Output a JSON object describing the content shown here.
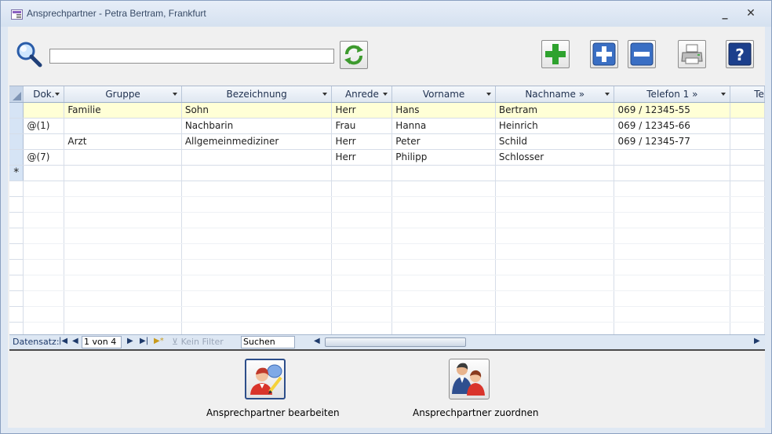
{
  "window": {
    "title": "Ansprechpartner - Petra Bertram, Frankfurt",
    "minimize_glyph": "_",
    "close_glyph": "✕"
  },
  "toolbar": {
    "search_value": "",
    "icons": [
      "search-icon",
      "refresh-icon",
      "add-icon",
      "plus-icon",
      "minus-icon",
      "print-icon",
      "help-icon"
    ]
  },
  "grid": {
    "columns": [
      {
        "label": "Dok.",
        "dropdown": true
      },
      {
        "label": "Gruppe",
        "dropdown": true
      },
      {
        "label": "Bezeichnung",
        "dropdown": true
      },
      {
        "label": "Anrede",
        "dropdown": true
      },
      {
        "label": "Vorname",
        "dropdown": true
      },
      {
        "label": "Nachname »",
        "dropdown": true
      },
      {
        "label": "Telefon 1 »",
        "dropdown": true
      },
      {
        "label": "Te",
        "dropdown": false
      }
    ],
    "rows": [
      [
        "",
        "Familie",
        "Sohn",
        "Herr",
        "Hans",
        "Bertram",
        "069 / 12345-55",
        ""
      ],
      [
        "@(1)",
        "",
        "Nachbarin",
        "Frau",
        "Hanna",
        "Heinrich",
        "069 / 12345-66",
        ""
      ],
      [
        "",
        "Arzt",
        "Allgemeinmediziner",
        "Herr",
        "Peter",
        "Schild",
        "069 / 12345-77",
        ""
      ],
      [
        "@(7)",
        "",
        "",
        "Herr",
        "Philipp",
        "Schlosser",
        "",
        ""
      ]
    ],
    "new_record_marker": "*",
    "current_row_index": 0
  },
  "navigation": {
    "label": "Datensatz:",
    "position": "1 von 4",
    "filter_label": "Kein Filter",
    "search_label": "Suchen"
  },
  "actions": {
    "edit_label": "Ansprechpartner bearbeiten",
    "assign_label": "Ansprechpartner zuordnen"
  },
  "colors": {
    "current_row": "#ffffd6",
    "selector_column": "#d6e4f5",
    "accent_blue": "#2d4e8a"
  }
}
